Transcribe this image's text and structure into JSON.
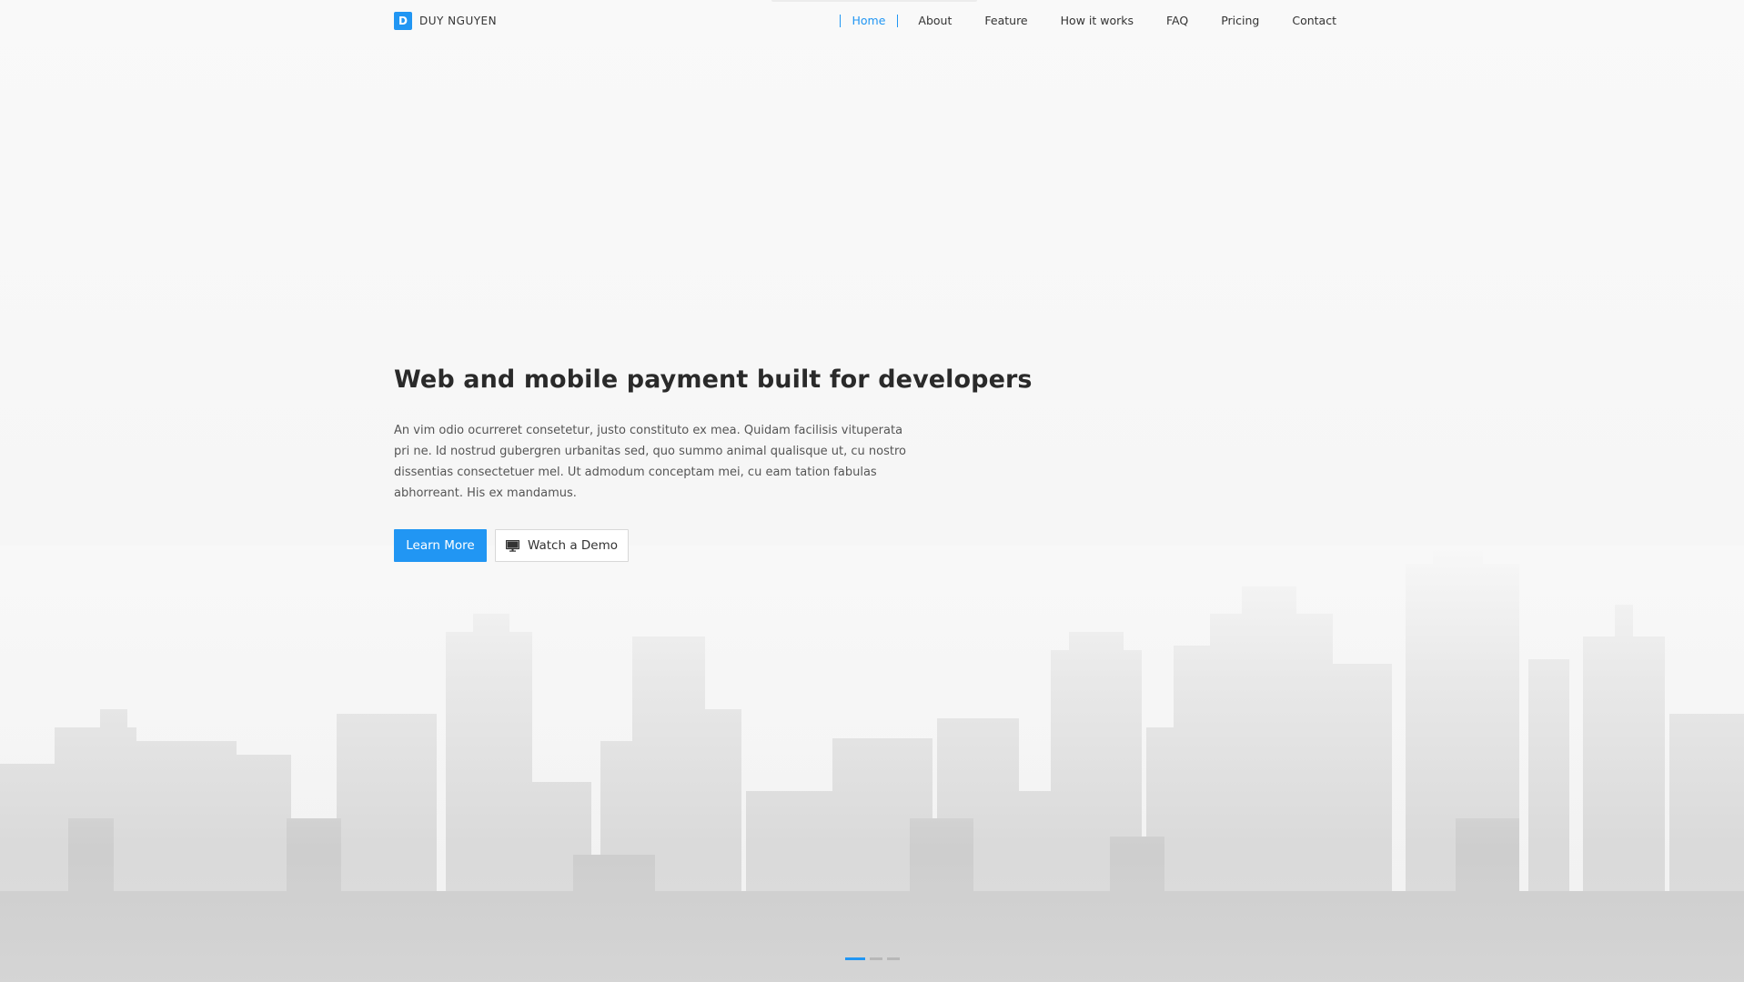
{
  "brand": {
    "mark": "D",
    "name": "DUY NGUYEN"
  },
  "nav": {
    "items": [
      {
        "label": "Home",
        "active": true
      },
      {
        "label": "About",
        "active": false
      },
      {
        "label": "Feature",
        "active": false
      },
      {
        "label": "How it works",
        "active": false
      },
      {
        "label": "FAQ",
        "active": false
      },
      {
        "label": "Pricing",
        "active": false
      },
      {
        "label": "Contact",
        "active": false
      }
    ]
  },
  "hero": {
    "headline": "Web and mobile payment built for developers",
    "lead": "An vim odio ocurreret consetetur, justo constituto ex mea. Quidam facilisis vituperata pri ne. Id nostrud gubergren urbanitas sed, quo summo animal qualisque ut, cu nostro dissentias consectetuer mel. Ut admodum conceptam mei, cu eam tation fabulas abhorreant. His ex mandamus.",
    "primary_button": "Learn More",
    "secondary_button": "Watch a Demo",
    "secondary_icon": "monitor-icon"
  },
  "slider": {
    "count": 3,
    "active_index": 0
  },
  "colors": {
    "accent": "#2196f3",
    "background": "#f8f8f8",
    "text": "#222222"
  }
}
